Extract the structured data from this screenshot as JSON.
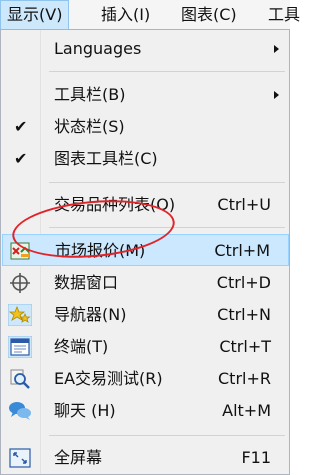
{
  "menubar": {
    "items": [
      "显示(V)",
      "插入(I)",
      "图表(C)",
      "工具"
    ]
  },
  "menu": {
    "languages": {
      "label": "Languages"
    },
    "toolbars": {
      "label": "工具栏(B)"
    },
    "statusbar": {
      "label": "状态栏(S)",
      "check": "✔"
    },
    "chart_toolbar": {
      "label": "图表工具栏(C)",
      "check": "✔"
    },
    "symbols": {
      "label": "交易品种列表(O)",
      "shortcut": "Ctrl+U"
    },
    "market_watch": {
      "label": "市场报价(M)",
      "shortcut": "Ctrl+M"
    },
    "data_window": {
      "label": "数据窗口",
      "shortcut": "Ctrl+D"
    },
    "navigator": {
      "label": "导航器(N)",
      "shortcut": "Ctrl+N"
    },
    "terminal": {
      "label": "终端(T)",
      "shortcut": "Ctrl+T"
    },
    "strategy_tester": {
      "label": "EA交易测试(R)",
      "shortcut": "Ctrl+R"
    },
    "chat": {
      "label": "聊天 (H)",
      "shortcut": "Alt+M"
    },
    "fullscreen": {
      "label": "全屏幕",
      "shortcut": "F11"
    }
  },
  "colors": {
    "highlight": "#cce8ff",
    "annotation": "#e0242a"
  },
  "icons": [
    "market-watch-icon",
    "crosshair-icon",
    "navigator-stars-icon",
    "terminal-window-icon",
    "tester-magnifier-icon",
    "chat-bubbles-icon",
    "fullscreen-icon"
  ]
}
